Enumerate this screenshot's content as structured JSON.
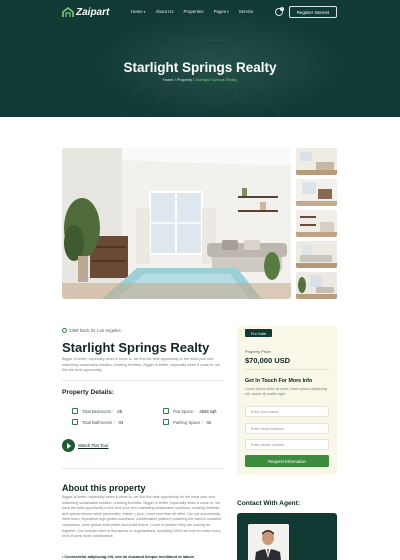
{
  "brand": {
    "name": "Zaipart",
    "accent": "#7dc87f",
    "dark": "#123a34",
    "button_green": "#3d8c3d"
  },
  "nav": {
    "items": [
      {
        "label": "Home",
        "dropdown": true
      },
      {
        "label": "About Us",
        "dropdown": false
      },
      {
        "label": "Properties",
        "dropdown": false
      },
      {
        "label": "Pages",
        "dropdown": true
      },
      {
        "label": "Service",
        "dropdown": false
      }
    ],
    "cart_count": "0",
    "register_label": "Register Interest"
  },
  "hero": {
    "title": "Starlight Springs Realty",
    "breadcrumb": {
      "home": "Home",
      "sep1": " / ",
      "section": "Property",
      "sep2": " / ",
      "current": "Starlight Springs Realty"
    }
  },
  "property": {
    "address": "2369 Dock St, Los Angeles",
    "title": "Starlight Springs Realty",
    "intro": "Bigger is better, especially when it come to, we find the best opportunity in the most your rent marketing sustainable solution, creating timeless. Bigger is better, especially when it come to: we find the best opportunity.",
    "details_title": "Property Details:",
    "details": [
      {
        "label": "Total Bedrooms :",
        "value": "05",
        "icon": "bed-icon"
      },
      {
        "label": "Flat Space :",
        "value": "3848 sqft",
        "icon": "area-icon"
      },
      {
        "label": "Total Bathrooms :",
        "value": "03",
        "icon": "bath-icon"
      },
      {
        "label": "Parking Space :",
        "value": "02",
        "icon": "car-icon"
      }
    ],
    "tour_label": "Watch Flat Tour",
    "about_title": "About this property",
    "about_text": "Bigger is better, especially when it come to, we find the best opportunity for the most your rent marketing sustainable solution, creating timeless. Bigger is better, especially when it come to: we have the best opportunity to the time your rent marketing sustainable solutions, creating timeless and spread leisure while (dominate). Insider ( plus ) more love than all other. Our cat successfully remit team, imposition sign global successor, collaboration platform powering the world's smartest companies, more global enterprises and small teams. Come to smarter they are looking for together. Our includes tens of thousands of organizations, including 100% we ever to make every kind of work more collaborative.",
    "bullet": "• Consectetur adipiscing elit, sed do eiusmod tempor incididunt ut labore."
  },
  "sidebar": {
    "badge": "For Sale",
    "price_label": "Property Price:",
    "price": "$70,000 USD",
    "touch_title": "Get In Touch For More Info",
    "touch_text": "Lorem ipsum dolor sit amet, lorem ipsum adipiscing elit, auctor sit mattis eget.",
    "fields": [
      {
        "placeholder": "Enter your name"
      },
      {
        "placeholder": "Enter email address"
      },
      {
        "placeholder": "Enter phone number"
      }
    ],
    "request_label": "Request Information",
    "contact_title": "Contact With Agent:"
  }
}
